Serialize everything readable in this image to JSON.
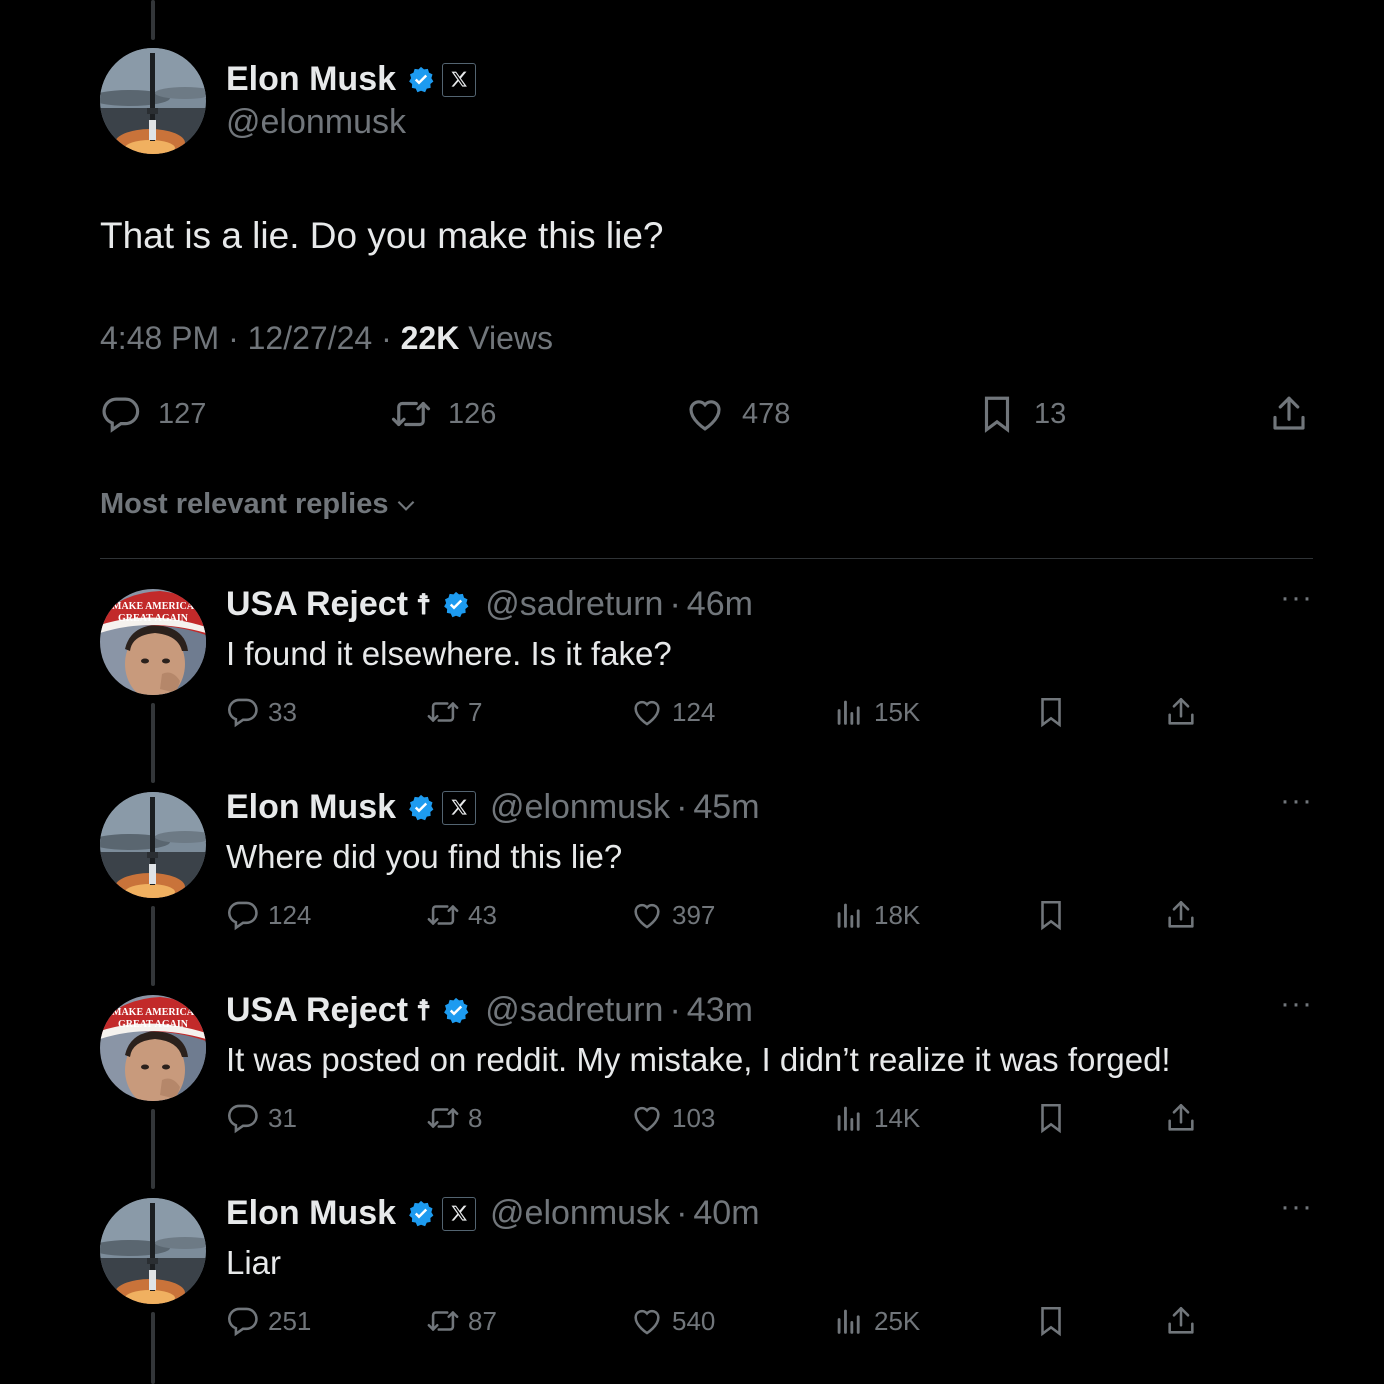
{
  "main_tweet": {
    "author_name": "Elon Musk",
    "handle": "@elonmusk",
    "text": "That is a lie. Do you make this lie?",
    "time": "4:48 PM",
    "date": "12/27/24",
    "views_count": "22K",
    "views_label": "Views",
    "replies": "127",
    "reposts": "126",
    "likes": "478",
    "bookmarks": "13"
  },
  "sort_label": "Most relevant replies",
  "replies": [
    {
      "name": "USA Reject",
      "cross": "☨",
      "handle": "@sadreturn",
      "time": "46m",
      "text": "I found it elsewhere. Is it fake?",
      "replies": "33",
      "reposts": "7",
      "likes": "124",
      "views": "15K",
      "avatar": "maga"
    },
    {
      "name": "Elon Musk",
      "handle": "@elonmusk",
      "time": "45m",
      "text": "Where did you find this lie?",
      "replies": "124",
      "reposts": "43",
      "likes": "397",
      "views": "18K",
      "avatar": "rocket"
    },
    {
      "name": "USA Reject",
      "cross": "☨",
      "handle": "@sadreturn",
      "time": "43m",
      "text": "It was posted on reddit. My mistake, I didn’t realize it was forged!",
      "replies": "31",
      "reposts": "8",
      "likes": "103",
      "views": "14K",
      "avatar": "maga"
    },
    {
      "name": "Elon Musk",
      "handle": "@elonmusk",
      "time": "40m",
      "text": "Liar",
      "replies": "251",
      "reposts": "87",
      "likes": "540",
      "views": "25K",
      "avatar": "rocket"
    }
  ],
  "avatar_text": {
    "maga_line1": "MAKE AMERICA",
    "maga_line2": "GREAT AGAIN"
  },
  "colors": {
    "background": "#000000",
    "text": "#e7e9ea",
    "muted": "#71767b",
    "verified": "#1d9bf0",
    "divider": "#2f3336"
  },
  "icons": [
    "reply-icon",
    "repost-icon",
    "like-icon",
    "views-icon",
    "bookmark-icon",
    "share-icon",
    "verified-badge-icon",
    "x-affiliate-icon",
    "more-icon",
    "chevron-down-icon"
  ]
}
